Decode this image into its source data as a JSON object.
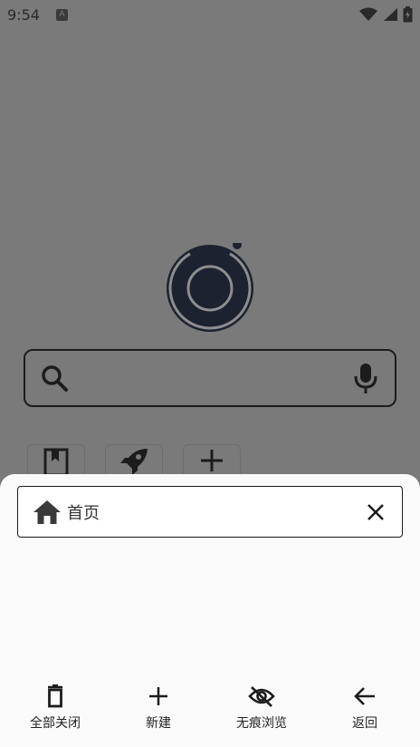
{
  "status_bar": {
    "time": "9:54",
    "notification_icon": "text-a-icon",
    "icons": [
      "wifi-icon",
      "cell-signal-icon",
      "battery-charging-icon"
    ]
  },
  "home": {
    "logo_icon": "camera-lens-logo",
    "search_icon": "search-icon",
    "mic_icon": "mic-icon",
    "shortcuts": [
      "bookmark-icon",
      "rocket-icon",
      "add-icon"
    ]
  },
  "tabs_sheet": {
    "tabs": [
      {
        "title": "首页",
        "icon": "home-icon",
        "close_icon": "close-icon"
      }
    ],
    "actions": [
      {
        "label": "全部关闭",
        "icon": "trash-icon"
      },
      {
        "label": "新建",
        "icon": "add-icon"
      },
      {
        "label": "无痕浏览",
        "icon": "eye-off-icon"
      },
      {
        "label": "返回",
        "icon": "arrow-left-icon"
      }
    ]
  },
  "colors": {
    "scrim": "#7a7a7a",
    "sheet_bg": "#fafafa",
    "ink": "#1a1a1a"
  }
}
